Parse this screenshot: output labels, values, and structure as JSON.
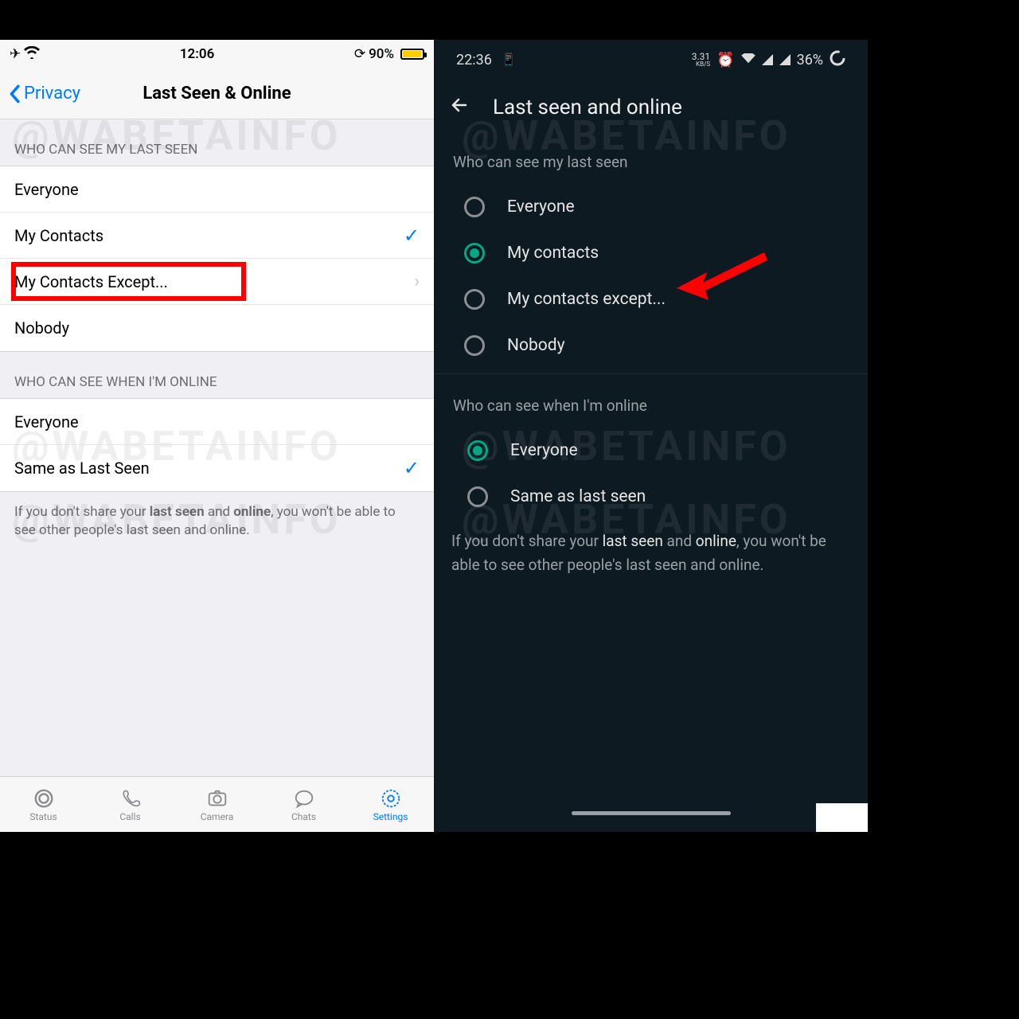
{
  "watermark": "@WABETAINFO",
  "ios": {
    "status": {
      "time": "12:06",
      "battery_pct": "90%"
    },
    "nav": {
      "back": "Privacy",
      "title": "Last Seen & Online"
    },
    "section1": "WHO CAN SEE MY LAST SEEN",
    "options1": {
      "everyone": "Everyone",
      "my_contacts": "My Contacts",
      "my_contacts_except": "My Contacts Except...",
      "nobody": "Nobody"
    },
    "section2": "WHO CAN SEE WHEN I'M ONLINE",
    "options2": {
      "everyone": "Everyone",
      "same_as": "Same as Last Seen"
    },
    "footer_pre": "If you don't share your ",
    "footer_b1": "last seen",
    "footer_mid": " and ",
    "footer_b2": "online",
    "footer_post": ", you won't be able to see other people's last seen and online.",
    "tabs": {
      "status": "Status",
      "calls": "Calls",
      "camera": "Camera",
      "chats": "Chats",
      "settings": "Settings"
    }
  },
  "android": {
    "status": {
      "time": "22:36",
      "net": "3.31",
      "net_unit": "KB/S",
      "battery_pct": "36%"
    },
    "nav": {
      "title": "Last seen and online"
    },
    "section1": "Who can see my last seen",
    "options1": {
      "everyone": "Everyone",
      "my_contacts": "My contacts",
      "my_contacts_except": "My contacts except...",
      "nobody": "Nobody"
    },
    "section2": "Who can see when I'm online",
    "options2": {
      "everyone": "Everyone",
      "same_as": "Same as last seen"
    },
    "footer_pre": "If you don't share your ",
    "footer_b1": "last seen",
    "footer_mid": " and ",
    "footer_b2": "online",
    "footer_post": ", you won't be able to see other people's last seen and online."
  }
}
